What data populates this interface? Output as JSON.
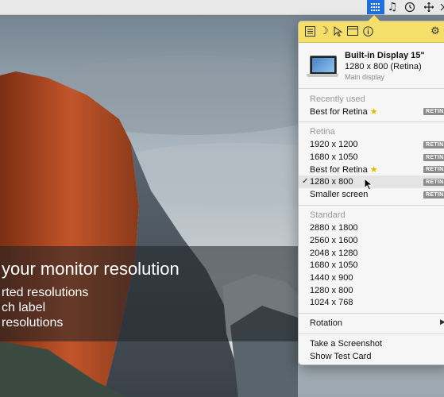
{
  "menubar": {
    "icons": [
      "grid-icon",
      "music-icon",
      "clock-icon",
      "move-icon"
    ]
  },
  "banner": {
    "line1": "your monitor resolution",
    "line2": "rted resolutions",
    "line3": "ch label",
    "line4": "resolutions"
  },
  "popover": {
    "toolbar_icons": [
      "list-icon",
      "moon-icon",
      "pointer-icon",
      "window-icon",
      "info-icon",
      "gear-icon"
    ],
    "display": {
      "name": "Built-in Display 15\"",
      "resolution": "1280 x 800 (Retina)",
      "subtitle": "Main display"
    },
    "recent": {
      "title": "Recently used",
      "items": [
        {
          "label": "Best for Retina",
          "star": true,
          "badge": "RETINA"
        }
      ]
    },
    "retina": {
      "title": "Retina",
      "items": [
        {
          "label": "1920 x 1200",
          "badge": "RETINA"
        },
        {
          "label": "1680 x 1050",
          "badge": "RETINA"
        },
        {
          "label": "Best for Retina",
          "star": true,
          "badge": "RETINA"
        },
        {
          "label": "1280 x 800",
          "badge": "RETINA",
          "checked": true
        },
        {
          "label": "Smaller screen",
          "badge": "RETINA"
        }
      ]
    },
    "standard": {
      "title": "Standard",
      "items": [
        "2880 x 1800",
        "2560 x 1600",
        "2048 x 1280",
        "1680 x 1050",
        "1440 x 900",
        "1280 x 800",
        "1024 x 768"
      ]
    },
    "rotation_label": "Rotation",
    "screenshot_label": "Take a Screenshot",
    "testcard_label": "Show Test Card",
    "check_glyph": "✓",
    "star_glyph": "★"
  },
  "colors": {
    "toolbar": "#f5df6b",
    "menubar_active": "#1f6fe0",
    "badge": "#8c8c8c"
  }
}
